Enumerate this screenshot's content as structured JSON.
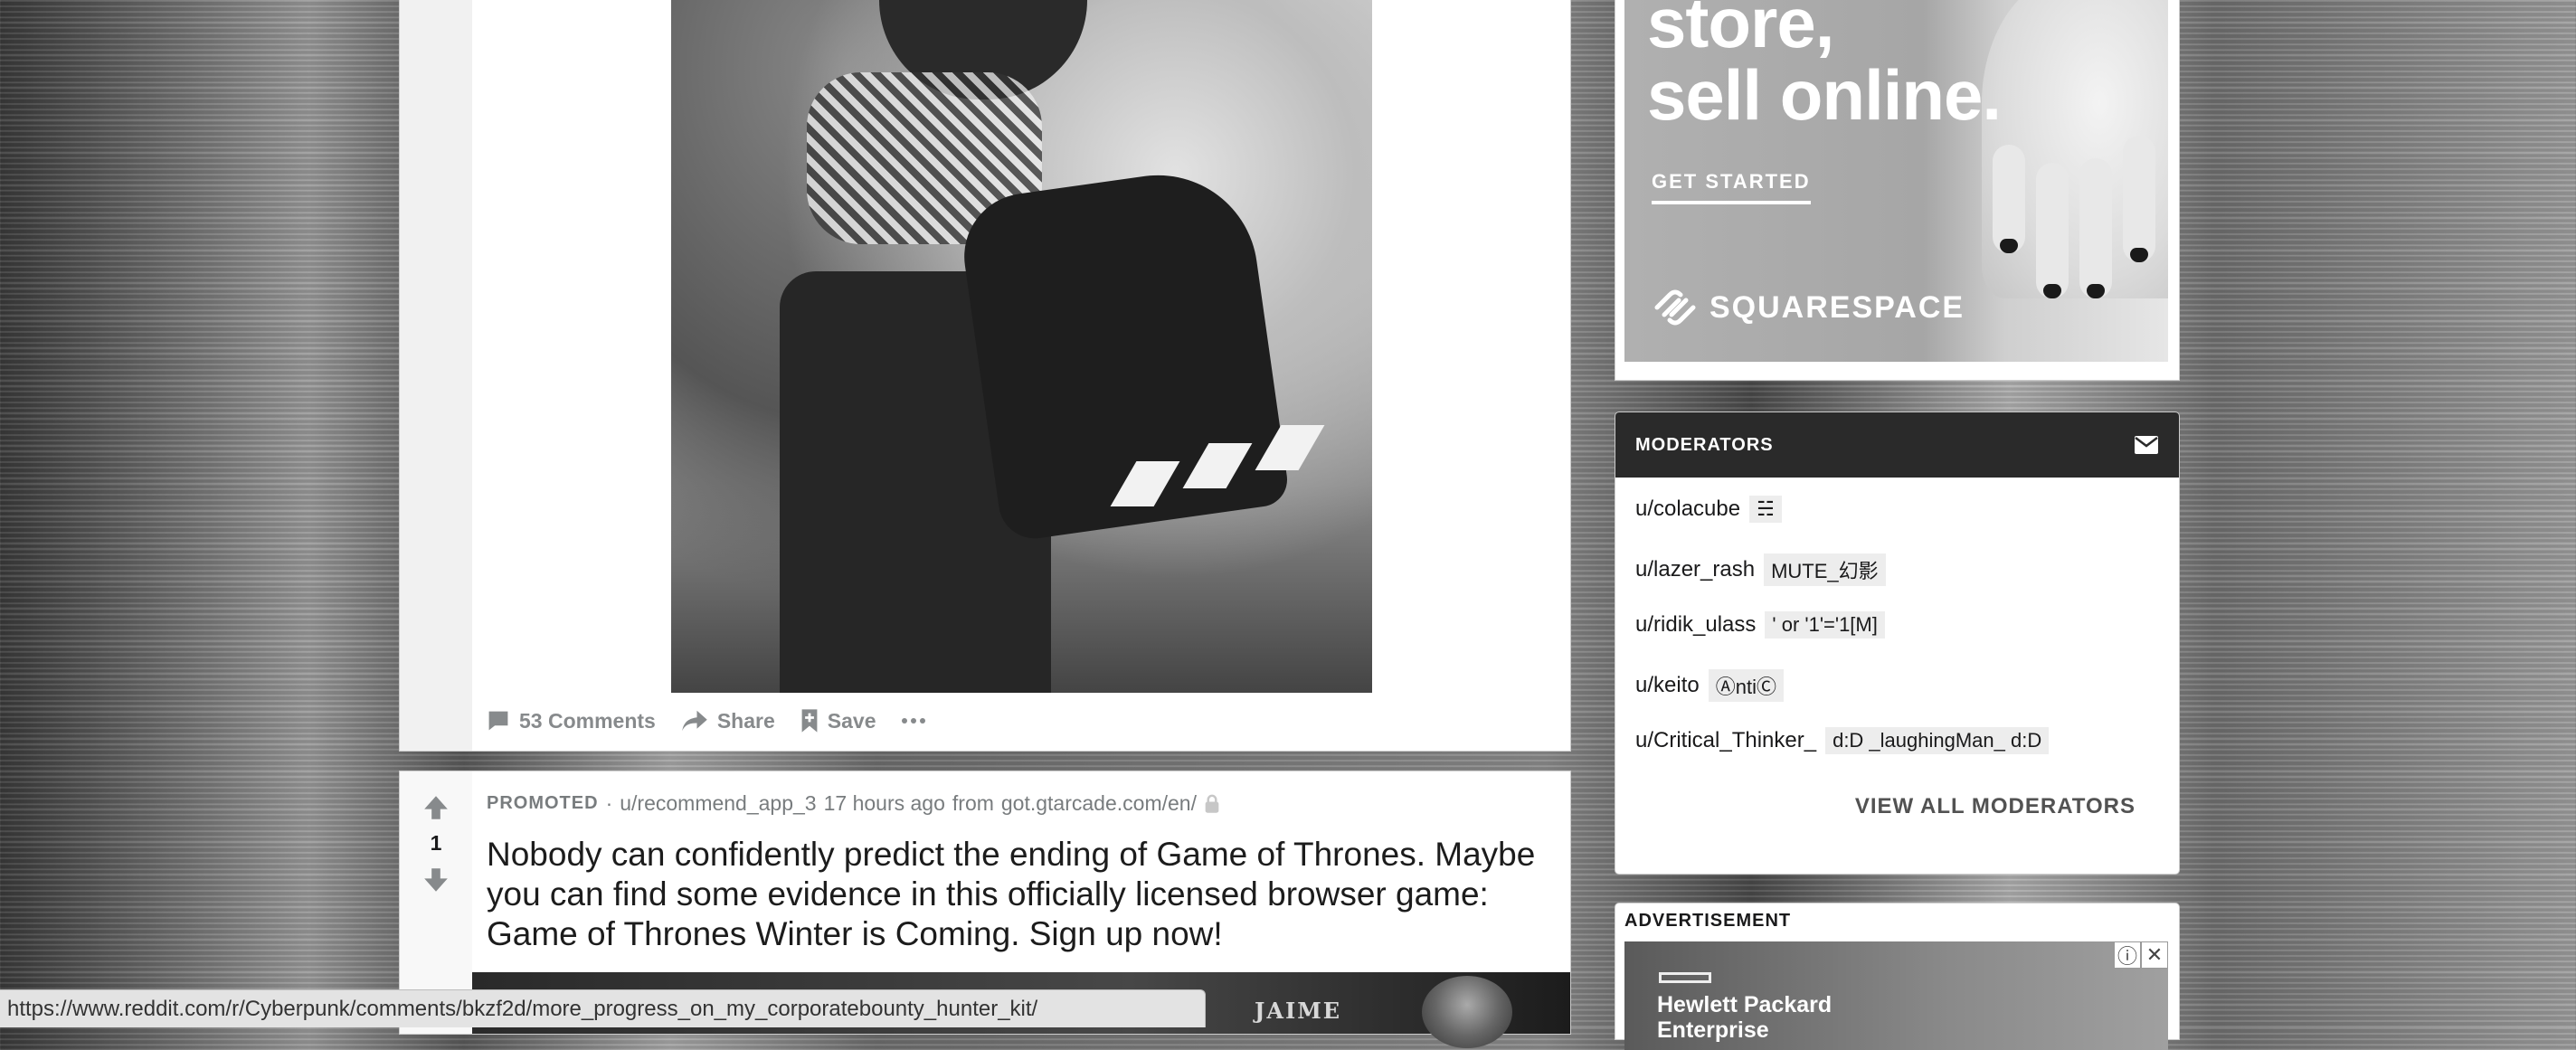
{
  "post": {
    "actions": {
      "comments": "53 Comments",
      "share": "Share",
      "save": "Save"
    }
  },
  "promoted": {
    "label": "PROMOTED",
    "separator": "·",
    "author": "u/recommend_app_3",
    "time": "17 hours ago",
    "from": "from",
    "domain": "got.gtarcade.com/en/",
    "vote_count": "1",
    "title": "Nobody can confidently predict the ending of Game of Thrones. Maybe you can find some evidence in this officially licensed browser game: Game of Thrones Winter is Coming. Sign up now!",
    "thumbnail_text": "JAIME"
  },
  "ad_top": {
    "headline_1": "store,",
    "headline_2": "sell online.",
    "cta": "GET STARTED",
    "brand": "SQUARESPACE"
  },
  "moderators": {
    "title": "MODERATORS",
    "list": [
      {
        "user": "u/colacube",
        "flair": "☵"
      },
      {
        "user": "u/lazer_rash",
        "flair": "MUTE_幻影"
      },
      {
        "user": "u/ridik_ulass",
        "flair": "' or '1'='1[M]"
      },
      {
        "user": "u/keito",
        "flair": "ⒶntiⒸ"
      },
      {
        "user": "u/Critical_Thinker_",
        "flair": "d:D _laughingMan_ d:D"
      }
    ],
    "view_all": "VIEW ALL MODERATORS"
  },
  "ad_bottom": {
    "label": "ADVERTISEMENT",
    "brand_line1": "Hewlett Packard",
    "brand_line2": "Enterprise",
    "info_icon": "ⓘ",
    "close_icon": "✕"
  },
  "status_url": "https://www.reddit.com/r/Cyberpunk/comments/bkzf2d/more_progress_on_my_corporatebounty_hunter_kit/",
  "colors": {
    "card_bg": "#ffffff",
    "mod_header": "#2a2a2a",
    "action_text": "#878a8c",
    "upvote": "#878a8c"
  }
}
